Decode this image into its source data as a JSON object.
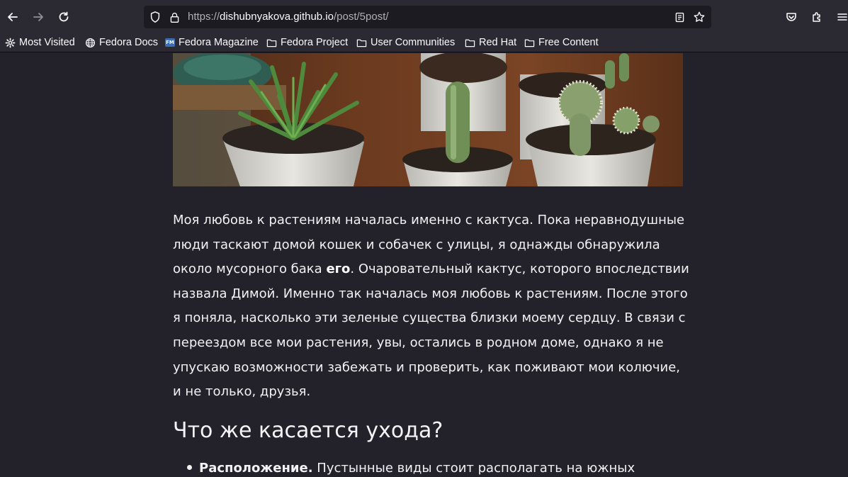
{
  "browser": {
    "url_prefix": "https://",
    "url_host": "dishubnyakova.github.io",
    "url_path": "/post/5post/",
    "nav_icons": [
      "back-arrow-icon",
      "forward-arrow-icon",
      "reload-icon"
    ],
    "urlbar_icons": [
      "shield-icon",
      "lock-icon",
      "reader-view-icon",
      "bookmark-star-icon"
    ],
    "right_icons": [
      "pocket-icon",
      "extensions-icon",
      "menu-icon"
    ]
  },
  "bookmarks": [
    {
      "label": "Most Visited",
      "icon": "gear-icon"
    },
    {
      "label": "Fedora Docs",
      "icon": "globe-icon"
    },
    {
      "label": "Fedora Magazine",
      "icon": "fedora-magazine-icon",
      "badge": "FM"
    },
    {
      "label": "Fedora Project",
      "icon": "folder-icon"
    },
    {
      "label": "User Communities",
      "icon": "folder-icon"
    },
    {
      "label": "Red Hat",
      "icon": "folder-icon"
    },
    {
      "label": "Free Content",
      "icon": "folder-icon"
    }
  ],
  "article": {
    "para_1": "Моя любовь к растениям началась именно с кактуса. Пока неравнодушные люди таскают домой кошек и собачек с улицы, я однажды обнаружила около мусорного бака ",
    "para_bold": "его",
    "para_2": ". Очаровательный кактус, которого впоследствии назвала Димой. Именно так началась моя любовь к растениям. После этого я поняла, насколько эти зеленые существа близки моему сердцу. В связи с переездом все мои растения, увы, остались в родном доме, однако я не упускаю возможности забежать и проверить, как поживают мои колючие, и не только, друзья.",
    "heading": "Что же касается ухода?",
    "list_bold": "Расположение.",
    "list_text": " Пустынные виды стоит располагать на южных"
  },
  "colors": {
    "page_bg": "#23222b",
    "toolbar_bg": "#2b2a33",
    "urlbar_bg": "#1c1b22",
    "text": "#fbfbfe"
  }
}
